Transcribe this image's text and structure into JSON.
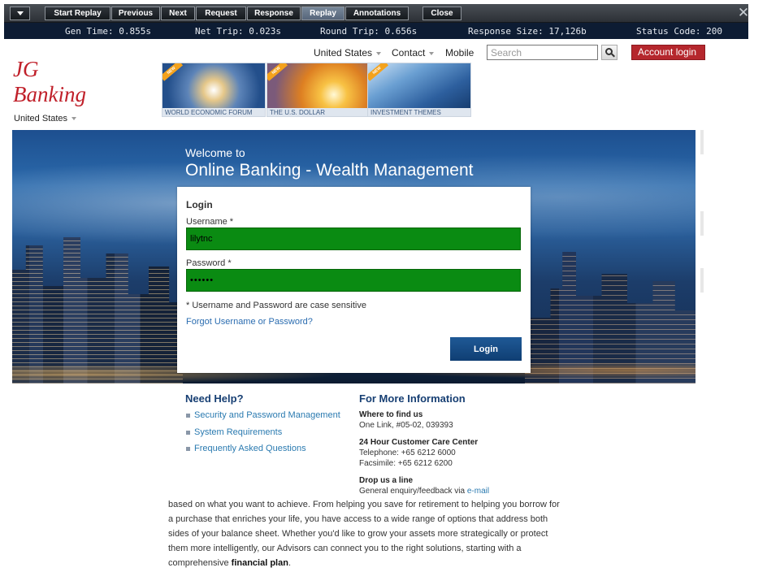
{
  "toolbar": {
    "buttons": [
      "Start Replay",
      "Previous",
      "Next",
      "Request",
      "Response",
      "Replay",
      "Annotations",
      "Close"
    ],
    "active": "Replay"
  },
  "status": {
    "gen_time": "Gen Time: 0.855s",
    "net_trip": "Net Trip: 0.023s",
    "round_trip": "Round Trip: 0.656s",
    "response_size": "Response Size: 17,126b",
    "status_code": "Status Code: 200"
  },
  "header": {
    "logo_line1": "JG",
    "logo_line2": "Banking",
    "logo_country": "United States",
    "nav_country": "United States",
    "nav_contact": "Contact",
    "nav_mobile": "Mobile",
    "search_placeholder": "Search",
    "account_login": "Account login",
    "promos": [
      {
        "ribbon": "NEW",
        "caption": "WORLD ECONOMIC FORUM"
      },
      {
        "ribbon": "NEW",
        "caption": "THE U.S. DOLLAR"
      },
      {
        "ribbon": "NEW",
        "caption": "INVESTMENT THEMES"
      }
    ]
  },
  "hero": {
    "welcome_small": "Welcome to",
    "welcome_big": "Online Banking - Wealth Management"
  },
  "login": {
    "title": "Login",
    "username_label": "Username *",
    "username_value": "lilytnc",
    "password_label": "Password *",
    "password_value": "••••••",
    "case_note": "* Username and Password are case sensitive",
    "forgot": "Forgot Username or Password?",
    "button": "Login"
  },
  "help": {
    "title": "Need Help?",
    "links": [
      "Security and Password Management",
      "System Requirements",
      "Frequently Asked Questions"
    ]
  },
  "info": {
    "title": "For More Information",
    "where_head": "Where to find us",
    "where_text": "One Link, #05-02, 039393",
    "care_head": "24 Hour Customer Care Center",
    "telephone": "Telephone: +65 6212 6000",
    "facsimile": "Facsimile: +65 6212 6200",
    "drop_head": "Drop us a line",
    "drop_text": "General enquiry/feedback via ",
    "email_link": "e-mail"
  },
  "body_copy": {
    "text": "based on what you want to achieve. From helping you save for retirement to helping you borrow for a purchase that enriches your life, you have access to a wide range of options that address both sides of your balance sheet. Whether you'd like to grow your assets more strategically or protect them more intelligently, our Advisors can connect you to the right solutions, starting with a comprehensive ",
    "bold": "financial plan",
    "end": "."
  }
}
